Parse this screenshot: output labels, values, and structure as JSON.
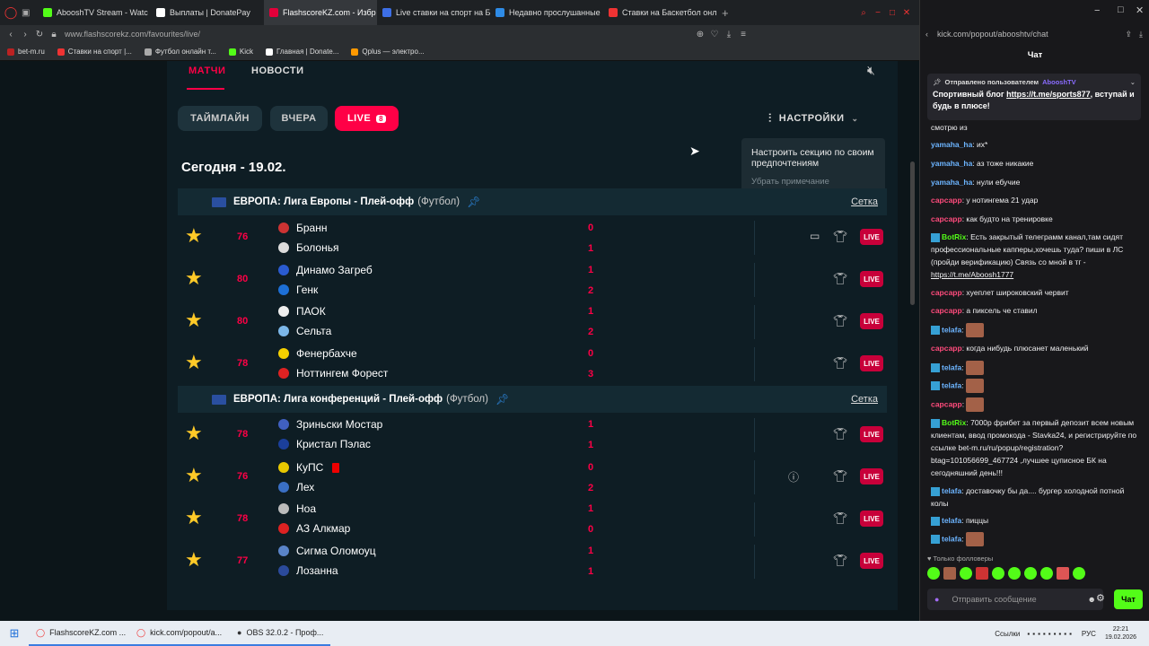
{
  "browser": {
    "tabs": [
      {
        "title": "AbooshTV Stream - Watc",
        "color": "#53fc18"
      },
      {
        "title": "Выплаты | DonatePay",
        "color": "#fff"
      },
      {
        "title": "FlashscoreKZ.com - Избр",
        "color": "#e4003a",
        "active": true
      },
      {
        "title": "Live ставки на спорт на Б",
        "color": "#3d6fe6"
      },
      {
        "title": "Недавно прослушанные",
        "color": "#2e8be6"
      },
      {
        "title": "Ставки на Баскетбол онл",
        "color": "#e33"
      }
    ],
    "url": "www.flashscorekz.com/favourites/live/",
    "bookmarks": [
      "bet-m.ru",
      "Ставки на спорт |...",
      "Футбол онлайн т...",
      "Kick",
      "Главная | Donate...",
      "Qplus — электро..."
    ]
  },
  "flashscore": {
    "nav_tabs": [
      "МАТЧИ",
      "НОВОСТИ"
    ],
    "filters": {
      "timeline": "ТАЙМЛАЙН",
      "yesterday": "ВЧЕРА",
      "live": "LIVE",
      "live_count": "8"
    },
    "settings": "НАСТРОЙКИ",
    "tooltip": {
      "text": "Настроить секцию по своим предпочтениям",
      "dismiss": "Убрать примечание"
    },
    "date": "Сегодня - 19.02.",
    "leagues": [
      {
        "title": "ЕВРОПА: Лига Европы - Плей-офф",
        "sport": "(Футбол)",
        "link": "Сетка"
      },
      {
        "title": "ЕВРОПА: Лига конференций - Плей-офф",
        "sport": "(Футбол)",
        "link": "Сетка"
      }
    ],
    "matches": [
      {
        "minute": "76",
        "home": "Бранн",
        "away": "Болонья",
        "hs": "0",
        "as": "1",
        "live": "LIVE"
      },
      {
        "minute": "80",
        "home": "Динамо Загреб",
        "away": "Генк",
        "hs": "1",
        "as": "2",
        "live": "LIVE"
      },
      {
        "minute": "80",
        "home": "ПАОК",
        "away": "Сельта",
        "hs": "1",
        "as": "2",
        "live": "LIVE"
      },
      {
        "minute": "78",
        "home": "Фенербахче",
        "away": "Ноттингем Форест",
        "hs": "0",
        "as": "3",
        "live": "LIVE"
      },
      {
        "minute": "78",
        "home": "Зриньски Мостар",
        "away": "Кристал Пэлас",
        "hs": "1",
        "as": "1",
        "live": "LIVE"
      },
      {
        "minute": "76",
        "home": "КуПС",
        "away": "Лех",
        "hs": "0",
        "as": "2",
        "live": "LIVE"
      },
      {
        "minute": "78",
        "home": "Ноа",
        "away": "АЗ Алкмар",
        "hs": "1",
        "as": "0",
        "live": "LIVE"
      },
      {
        "minute": "77",
        "home": "Сигма Оломоуц",
        "away": "Лозанна",
        "hs": "1",
        "as": "1",
        "live": "LIVE"
      }
    ]
  },
  "chat": {
    "url": "kick.com/popout/abooshtv/chat",
    "title": "Чат",
    "pinned_by": "Отправлено пользователем",
    "pinned_user": "AbooshTV",
    "pinned_text": "Спортивный блог",
    "pinned_link": "https://t.me/sports877",
    "pinned_tail": ", вступай и будь в плюсе!",
    "messages": [
      {
        "user": "",
        "text": "смотрю из"
      },
      {
        "user": "yamaha_ha",
        "text": ": их*"
      },
      {
        "user": "yamaha_ha",
        "text": ": аз тоже никакие"
      },
      {
        "user": "yamaha_ha",
        "text": ": нули ебучие"
      },
      {
        "user": "сарсарр",
        "text": ": у нотингема 21 удар"
      },
      {
        "user": "сарсарр",
        "text": ": как будто на тренировке"
      },
      {
        "user": "BotRix",
        "text": ": Есть закрытый телеграмм канал,там сидят профессиональные капперы,хочешь туда? пиши в ЛС (пройди верификацию) Связь со мной в тг - ",
        "link": "https://t.me/Aboosh1777"
      },
      {
        "user": "сарсарр",
        "text": ": хуеплет широковский червит"
      },
      {
        "user": "сарсарр",
        "text": ": а пиксель че ставил"
      },
      {
        "user": "telafa",
        "text": ":"
      },
      {
        "user": "сарсарр",
        "text": ": когда нибудь плюсанет маленький"
      },
      {
        "user": "telafa",
        "text": ":"
      },
      {
        "user": "telafa",
        "text": ":"
      },
      {
        "user": "сарсарр",
        "text": ":"
      },
      {
        "user": "BotRix",
        "text": ": 7000р фрибет за первый депозит всем новым клиентам, ввод промокода - Stavka24, и регистрируйте по ссылке bet-m.ru/ru/popup/registration?btag=101056699_467724 ,лучшее цуписное БК на сегодняшний день!!!"
      },
      {
        "user": "telafa",
        "text": ": доставочку бы да.... бургер холодной потной колы"
      },
      {
        "user": "telafa",
        "text": ": пиццы"
      },
      {
        "user": "telafa",
        "text": ":"
      }
    ],
    "followers_only": "Только фолловеры",
    "input_placeholder": "Отправить сообщение",
    "send": "Чат"
  },
  "taskbar": {
    "items": [
      "FlashscoreKZ.com ...",
      "kick.com/popout/a...",
      "OBS 32.0.2 - Проф..."
    ],
    "links": "Ссылки",
    "lang": "РУС",
    "time": "22:21",
    "date": "19.02.2026"
  }
}
